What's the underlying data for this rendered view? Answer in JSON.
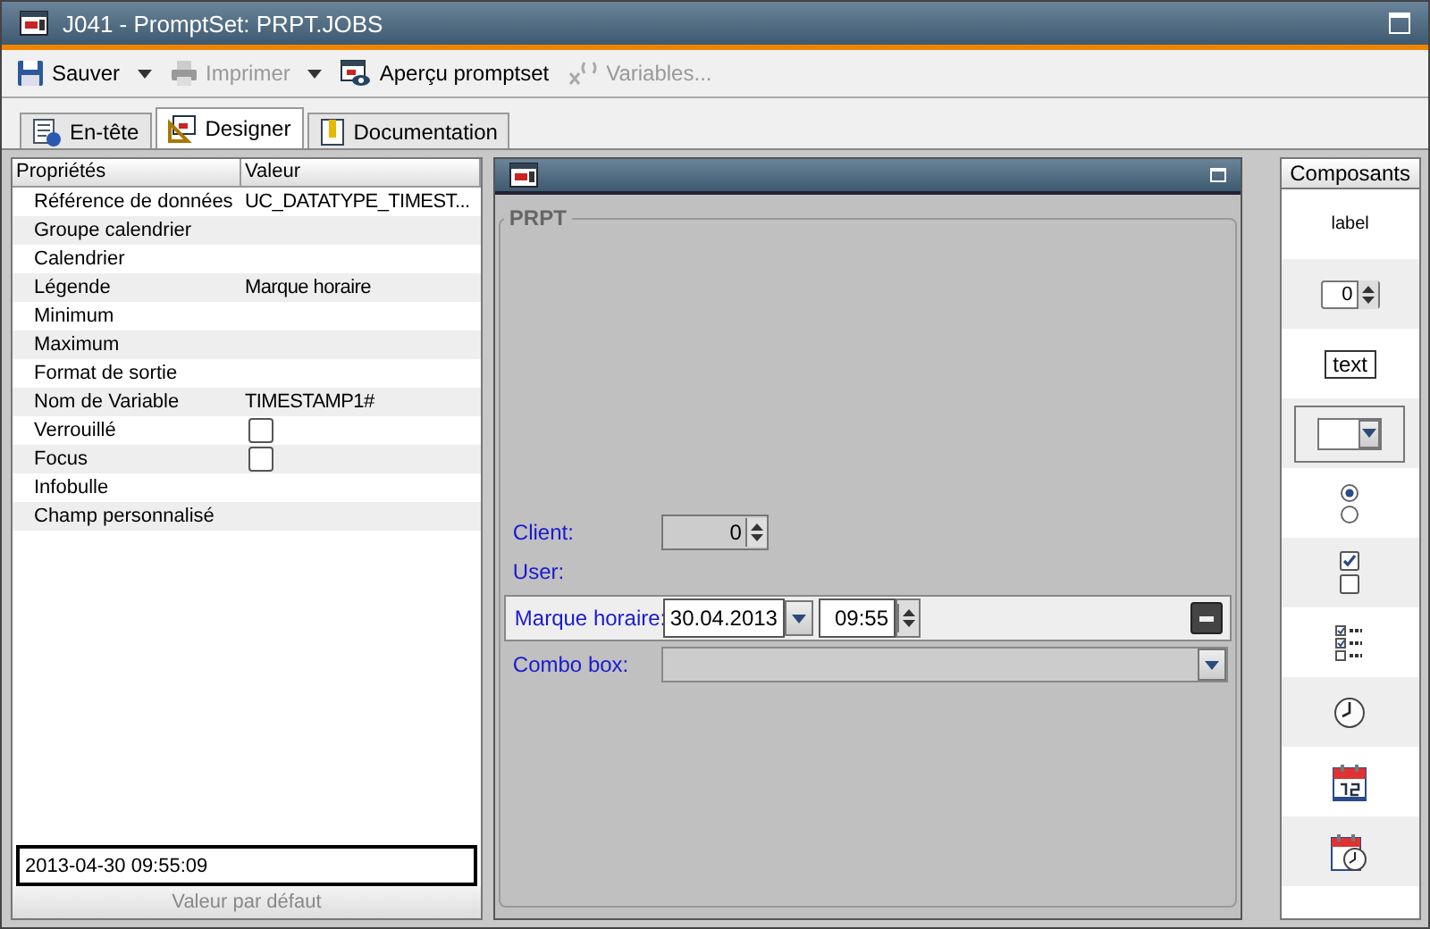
{
  "window": {
    "title": "J041 - PromptSet: PRPT.JOBS"
  },
  "toolbar": [
    {
      "label": "Sauver",
      "kind": "save",
      "disabled": false,
      "dropdown": true
    },
    {
      "label": "Imprimer",
      "kind": "print",
      "disabled": true,
      "dropdown": true
    },
    {
      "label": "Aperçu promptset",
      "kind": "preview",
      "disabled": false,
      "dropdown": false
    },
    {
      "label": "Variables...",
      "kind": "variables",
      "disabled": true,
      "dropdown": false
    }
  ],
  "tabs": [
    {
      "label": "En-tête",
      "kind": "header",
      "selected": false
    },
    {
      "label": "Designer",
      "kind": "designer",
      "selected": true
    },
    {
      "label": "Documentation",
      "kind": "doc",
      "selected": false
    }
  ],
  "properties": {
    "columns": [
      "Propriétés",
      "Valeur"
    ],
    "rows": [
      {
        "name": "Référence de données",
        "kind": "text",
        "value": "UC_DATATYPE_TIMEST..."
      },
      {
        "name": "Groupe calendrier",
        "kind": "text"
      },
      {
        "name": "Calendrier",
        "kind": "text"
      },
      {
        "name": "Légende",
        "kind": "text",
        "value": "Marque horaire"
      },
      {
        "name": "Minimum",
        "kind": "text"
      },
      {
        "name": "Maximum",
        "kind": "text"
      },
      {
        "name": "Format de sortie",
        "kind": "text"
      },
      {
        "name": "Nom de  Variable",
        "kind": "text",
        "value": "TIMESTAMP1#"
      },
      {
        "name": "Verrouillé",
        "kind": "checkbox",
        "checked": false
      },
      {
        "name": "Focus",
        "kind": "checkbox",
        "checked": false
      },
      {
        "name": "Infobulle",
        "kind": "text"
      },
      {
        "name": "Champ personnalisé",
        "kind": "text"
      }
    ],
    "default_value": "2013-04-30 09:55:09",
    "default_label": "Valeur par défaut"
  },
  "canvas": {
    "group_title": "PRPT",
    "fields": [
      {
        "label": "Client:",
        "kind": "spinner",
        "value": "0",
        "selected": false
      },
      {
        "label": "User:",
        "kind": "label",
        "selected": false
      },
      {
        "label": "Marque horaire:",
        "kind": "datetime",
        "date": "30.04.2013",
        "time": "09:55",
        "selected": true
      },
      {
        "label": "Combo box:",
        "kind": "combo",
        "selected": false
      }
    ]
  },
  "components": {
    "title": "Composants",
    "items": [
      {
        "kind": "label",
        "text": "label"
      },
      {
        "kind": "spinner",
        "text": "0"
      },
      {
        "kind": "text",
        "text": "text"
      },
      {
        "kind": "combo"
      },
      {
        "kind": "radio"
      },
      {
        "kind": "checkbox"
      },
      {
        "kind": "checklist"
      },
      {
        "kind": "clock"
      },
      {
        "kind": "calendar"
      },
      {
        "kind": "calendar-clock"
      }
    ]
  }
}
